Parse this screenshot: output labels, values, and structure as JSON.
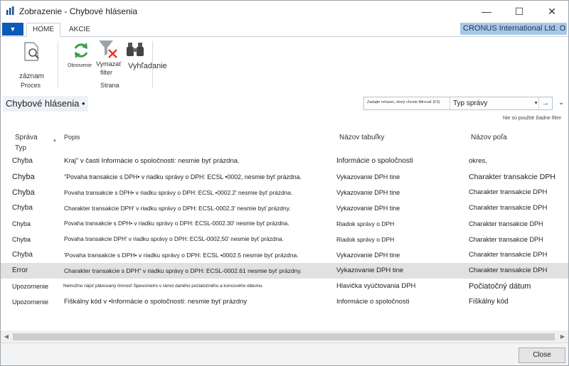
{
  "window": {
    "title": "Zobrazenie - Chybové hlásenia"
  },
  "ribbon": {
    "tabs": [
      "HOME",
      "AKCIE"
    ],
    "company": "CRONUS International Ltd. O",
    "zaznam_label": "záznam",
    "proces_group": "Proces",
    "obnovenie_label": "Obnovenie",
    "vymazat_label_1": "Vymazať",
    "vymazat_label_2": "filter",
    "vyhladanie_label": "Vyhľadanie",
    "strana_group": "Strana"
  },
  "page": {
    "title": "Chybové hlásenia •",
    "filter_hint": "Zadajte reťazec, ktorý chcete filtrovať (F3)",
    "filter_field": "Typ správy",
    "no_filters": "Nie sú použité žiadne filtre"
  },
  "grid": {
    "headers": {
      "col0_line1": "Správa",
      "col0_line2": "Typ",
      "col1": "Popis",
      "col2": "Názov tabuľky",
      "col3": "Názov poľa"
    },
    "rows": [
      [
        "Chyba",
        "Kraj\" v časti Informácie o spoločnosti: nesmie byť prázdna.",
        "Informácie o spoločnosti",
        "okres,"
      ],
      [
        "Chyba",
        "\"Povaha transakcie s DPH• v riadku správy o DPH: ECSL •0002, nesmie byť prázdna.",
        "Vykazovanie DPH tine",
        "Charakter transakcie DPH"
      ],
      [
        "Chyba",
        "Povaha transakcie s DPH• v riadku správy o DPH: ECSL •0002.2' nesmie byť prázdna.",
        "Vykazovanie DPH tine",
        "Charakter transakcie DPH"
      ],
      [
        "Chyba",
        "Charakter transakcie DPH' v riadku správy o DPH: ECSL-0002,3' nesmie byť prázdny.",
        "Vykazovanie DPH tine",
        "Charakter transakcie DPH"
      ],
      [
        "Chyba",
        "Povaha transakcie s DPH• v riadku správy o DPH: ECSL-0002.30' nesmie byť prázdna.",
        "Riadok správy o DPH",
        "Charakter transakcie DPH"
      ],
      [
        "Chyba",
        "Povaha transakcie DPH' v riadku správy o DPH: ECSL-0002,50' nesmie byť prázdna.",
        "Riadok správy o DPH",
        "Charakter transakcie DPH"
      ],
      [
        "Chyba",
        "'Povaha transakcie s DPH• v riadku správy o DPH: ECSL •0002.5 nesmie byť prázdna.",
        "Vykazovanie DPH tine",
        "Charakter transakcie DPH"
      ],
      [
        "Error",
        "Charakter transakcie s DPH\" v riadku správy o DPH: ECSL-0002.61 nesmie byť prázdny.",
        "Vykazovanie DPH tine",
        "Charakter transakcie DPH"
      ],
      [
        "Upozornenie",
        "Nemožno nájsť plánovaný činnosť Spesometro v rámci daného počiatočného a koncového dátumu.",
        "Hlavička vyúčtovania DPH",
        "Počiatočný dátum"
      ],
      [
        "Upozornenie",
        "Fiškálny kód v •Informácie o spoločnosti: nesmie byť prázdny",
        "Informácie o spoločnosti",
        "Fiškálny kód"
      ]
    ]
  },
  "footer": {
    "close_label": "Close"
  },
  "colors": {
    "accent": "#0a5cb8",
    "company_bg": "#a9c8e8",
    "selected_row": "#e1e1e1"
  }
}
